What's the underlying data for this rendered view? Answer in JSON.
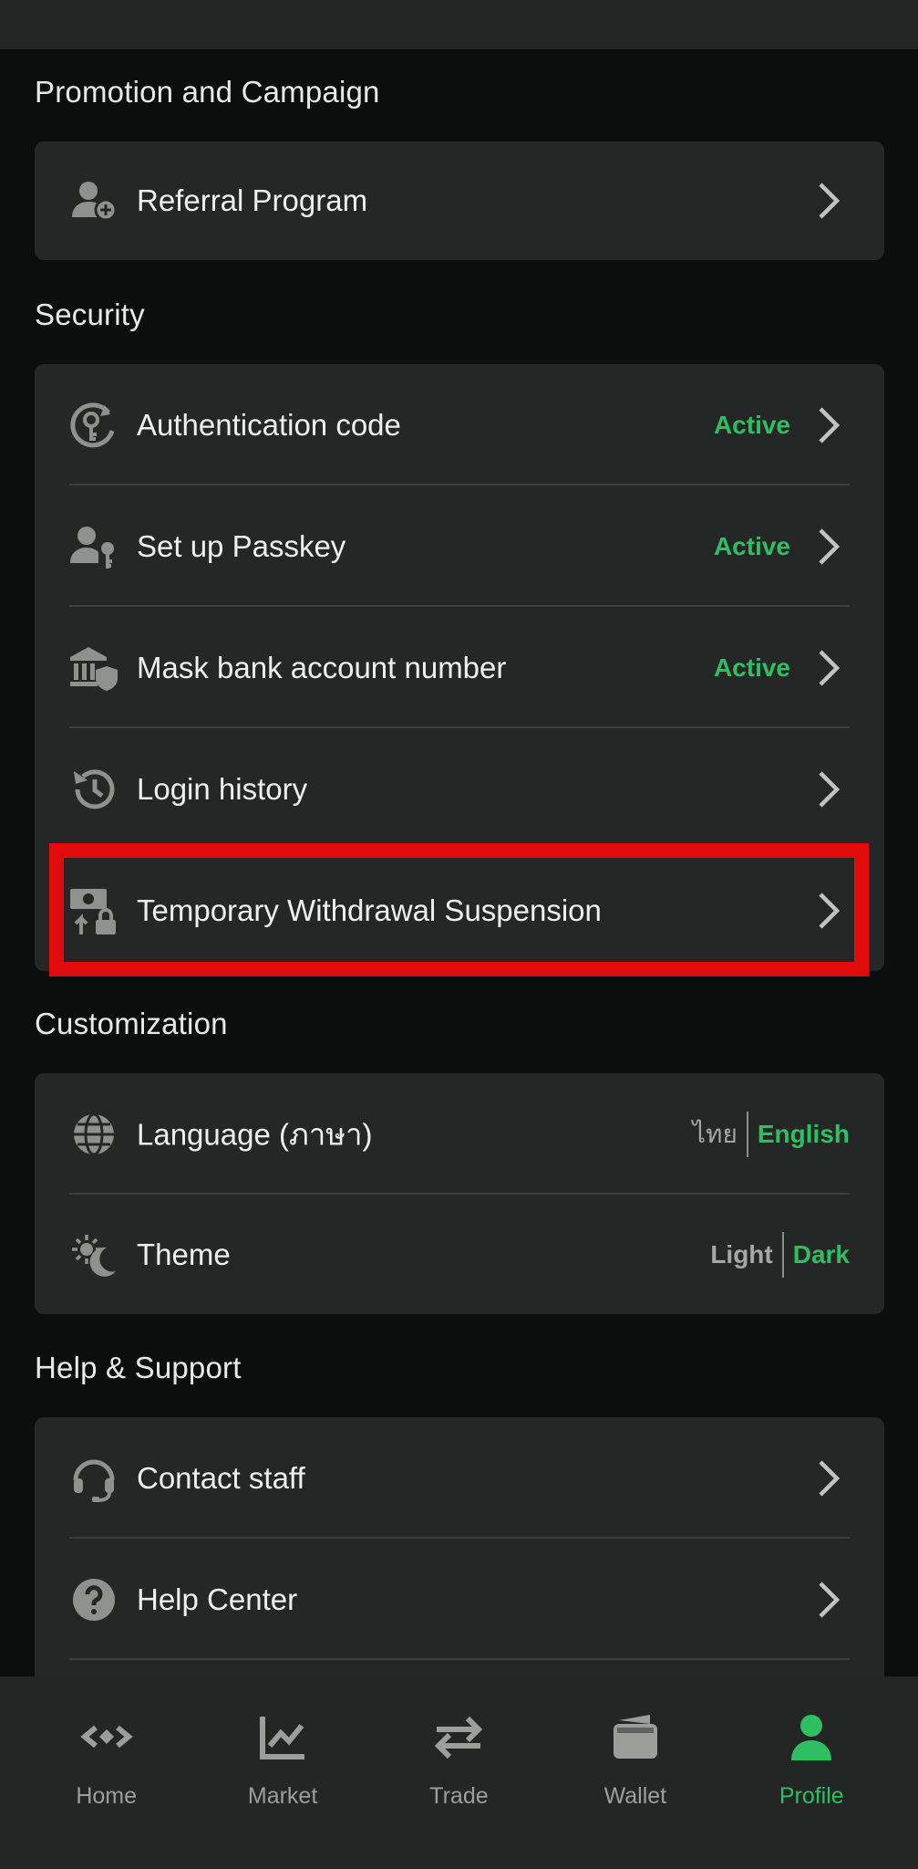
{
  "sections": {
    "promotion": {
      "title": "Promotion and Campaign",
      "items": [
        {
          "label": "Referral Program",
          "icon": "add-user-icon"
        }
      ]
    },
    "security": {
      "title": "Security",
      "items": [
        {
          "label": "Authentication code",
          "status": "Active",
          "icon": "key-refresh-icon"
        },
        {
          "label": "Set up Passkey",
          "status": "Active",
          "icon": "user-key-icon"
        },
        {
          "label": "Mask bank account number",
          "status": "Active",
          "icon": "bank-shield-icon"
        },
        {
          "label": "Login history",
          "icon": "history-icon"
        },
        {
          "label": "Temporary Withdrawal Suspension",
          "icon": "cash-lock-icon"
        }
      ]
    },
    "customization": {
      "title": "Customization",
      "language": {
        "label": "Language (ภาษา)",
        "option_thai": "ไทย",
        "option_english": "English",
        "icon": "globe-icon"
      },
      "theme": {
        "label": "Theme",
        "option_light": "Light",
        "option_dark": "Dark",
        "icon": "sun-moon-icon"
      }
    },
    "help": {
      "title": "Help & Support",
      "items": [
        {
          "label": "Contact staff",
          "icon": "headset-icon"
        },
        {
          "label": "Help Center",
          "icon": "question-icon"
        }
      ]
    }
  },
  "bottom_nav": [
    {
      "label": "Home",
      "icon": "home-icon"
    },
    {
      "label": "Market",
      "icon": "chart-icon"
    },
    {
      "label": "Trade",
      "icon": "swap-icon"
    },
    {
      "label": "Wallet",
      "icon": "wallet-icon"
    },
    {
      "label": "Profile",
      "icon": "profile-icon",
      "active": true
    }
  ],
  "colors": {
    "background": "#0b0e0d",
    "card": "#242726",
    "accent_green": "#2fbf62",
    "highlight_red": "#e10b0b"
  }
}
